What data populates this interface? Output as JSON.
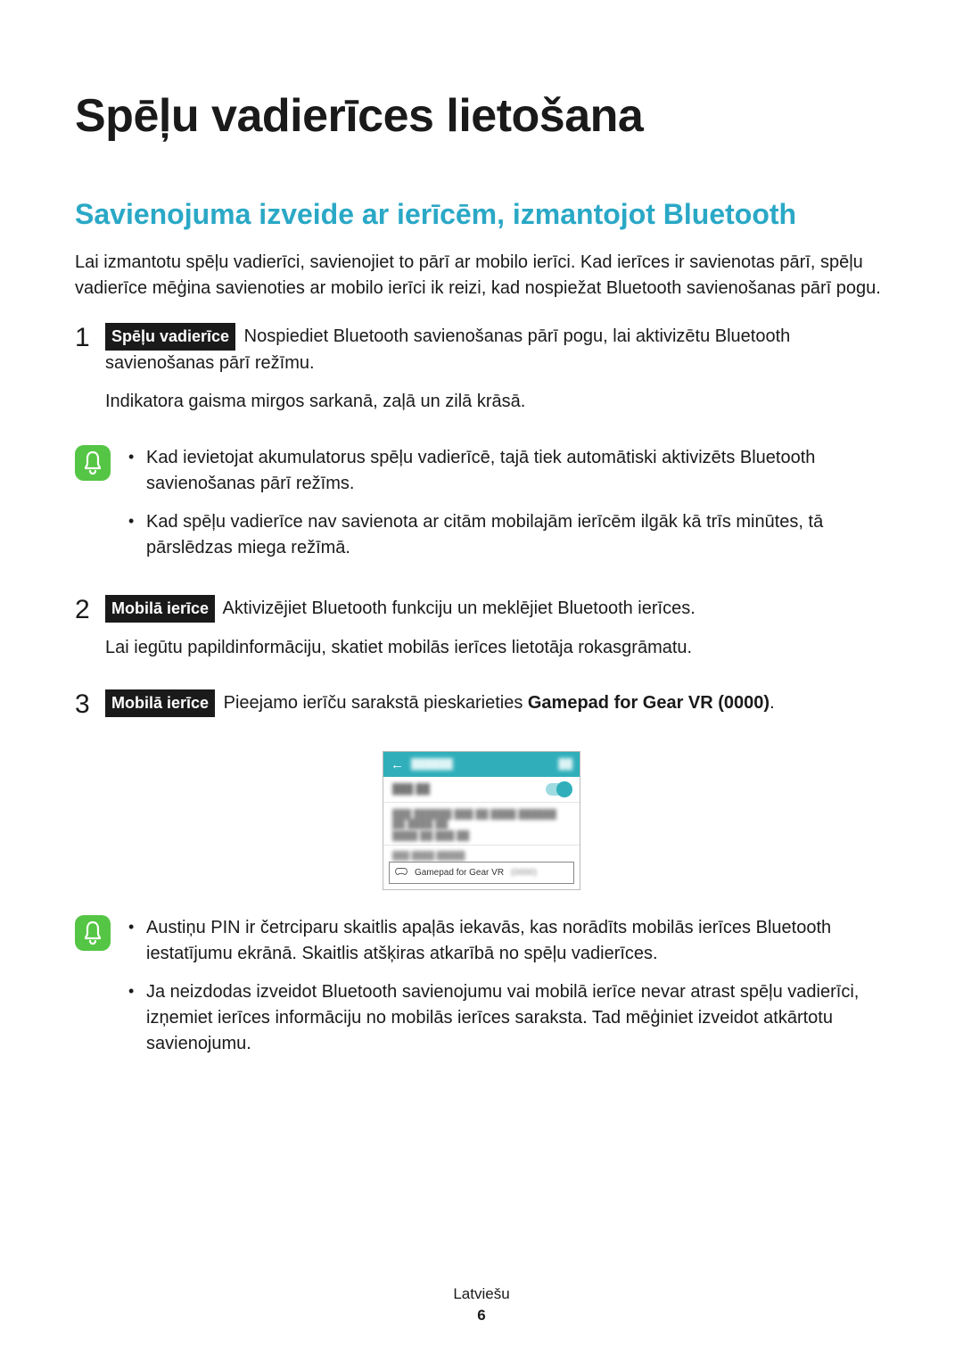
{
  "title": "Spēļu vadierīces lietošana",
  "section_title": "Savienojuma izveide ar ierīcēm, izmantojot Bluetooth",
  "intro": "Lai izmantotu spēļu vadierīci, savienojiet to pārī ar mobilo ierīci. Kad ierīces ir savienotas pārī, spēļu vadierīce mēģina savienoties ar mobilo ierīci ik reizi, kad nospiežat Bluetooth savienošanas pārī pogu.",
  "steps": {
    "s1": {
      "num": "1",
      "badge": "Spēļu vadierīce",
      "text": "Nospiediet Bluetooth savienošanas pārī pogu, lai aktivizētu Bluetooth savienošanas pārī režīmu.",
      "sub": "Indikatora gaisma mirgos sarkanā, zaļā un zilā krāsā."
    },
    "s2": {
      "num": "2",
      "badge": "Mobilā ierīce",
      "text": "Aktivizējiet Bluetooth funkciju un meklējiet Bluetooth ierīces.",
      "sub": "Lai iegūtu papildinformāciju, skatiet mobilās ierīces lietotāja rokasgrāmatu."
    },
    "s3": {
      "num": "3",
      "badge": "Mobilā ierīce",
      "prefix": "Pieejamo ierīču sarakstā pieskarieties ",
      "bold": "Gamepad for Gear VR (0000)",
      "suffix": "."
    }
  },
  "note1": {
    "b1": "Kad ievietojat akumulatorus spēļu vadierīcē, tajā tiek automātiski aktivizēts Bluetooth savienošanas pārī režīms.",
    "b2": "Kad spēļu vadierīce nav savienota ar citām mobilajām ierīcēm ilgāk kā trīs minūtes, tā pārslēdzas miega režīmā."
  },
  "note2": {
    "b1": "Austiņu PIN ir četrciparu skaitlis apaļās iekavās, kas norādīts mobilās ierīces Bluetooth iestatījumu ekrānā. Skaitlis atšķiras atkarībā no spēļu vadierīces.",
    "b2": "Ja neizdodas izveidot Bluetooth savienojumu vai mobilā ierīce nevar atrast spēļu vadierīci, izņemiet ierīces informāciju no mobilās ierīces saraksta. Tad mēģiniet izveidot atkārtotu savienojumu."
  },
  "screenshot": {
    "device_name": "Gamepad for Gear VR",
    "device_pin": "(0000)"
  },
  "footer": {
    "lang": "Latviešu",
    "page": "6"
  }
}
